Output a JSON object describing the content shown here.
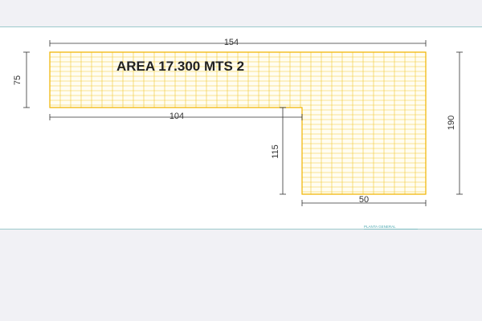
{
  "plan": {
    "area_label": "AREA 17.300 MTS 2",
    "dimensions": {
      "top_width": "154",
      "left_height": "75",
      "inner_width": "104",
      "inner_height": "115",
      "bottom_width": "50",
      "right_height": "190"
    },
    "caption": "PLANTA GENERAL"
  },
  "colors": {
    "page_background": "#f1f1f5",
    "sheet_background": "#ffffff",
    "sheet_border": "#9cc9cc",
    "grid_line": "#f2c830",
    "dimension_line": "#333333",
    "caption": "#4aa8b0"
  }
}
